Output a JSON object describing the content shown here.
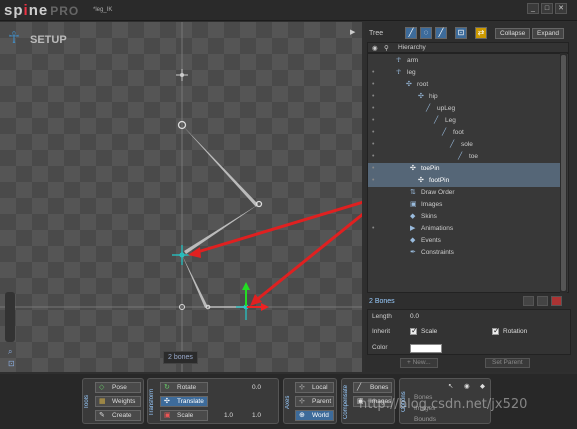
{
  "app": {
    "logo_main": "sp",
    "logo_dot": "i",
    "logo_end": "ne",
    "logo_pro": "PRO",
    "file_title": "*leg_IK",
    "min_label": "_",
    "max_label": "□",
    "close_label": "✕"
  },
  "viewport": {
    "mode_label": "SETUP",
    "status_label": "2 bones",
    "play_icon": "▶"
  },
  "tree_panel": {
    "title": "Tree",
    "collapse_label": "Collapse",
    "expand_label": "Expand",
    "header_label": "Hierarchy",
    "rows": [
      {
        "label": "arm",
        "icon": "figure-icon",
        "glyph": "☥",
        "indent": 28,
        "eye": "",
        "selected": false
      },
      {
        "label": "leg",
        "icon": "figure-icon",
        "glyph": "☥",
        "indent": 28,
        "eye": "•",
        "selected": false
      },
      {
        "label": "root",
        "icon": "root-bone-icon",
        "glyph": "✣",
        "indent": 38,
        "eye": "•",
        "selected": false
      },
      {
        "label": "hip",
        "icon": "bone-icon",
        "glyph": "✣",
        "indent": 50,
        "eye": "•",
        "selected": false
      },
      {
        "label": "upLeg",
        "icon": "bone-icon",
        "glyph": "╱",
        "indent": 58,
        "eye": "•",
        "selected": false
      },
      {
        "label": "Leg",
        "icon": "bone-icon",
        "glyph": "╱",
        "indent": 66,
        "eye": "•",
        "selected": false
      },
      {
        "label": "foot",
        "icon": "bone-icon",
        "glyph": "╱",
        "indent": 74,
        "eye": "•",
        "selected": false
      },
      {
        "label": "sole",
        "icon": "bone-icon",
        "glyph": "╱",
        "indent": 82,
        "eye": "•",
        "selected": false
      },
      {
        "label": "toe",
        "icon": "bone-icon",
        "glyph": "╱",
        "indent": 90,
        "eye": "•",
        "selected": false
      },
      {
        "label": "toePin",
        "icon": "target-bone-icon",
        "glyph": "✣",
        "indent": 42,
        "eye": "•",
        "selected": true
      },
      {
        "label": "footPin",
        "icon": "target-bone-icon",
        "glyph": "✣",
        "indent": 50,
        "eye": "•",
        "selected": true
      },
      {
        "label": "Draw Order",
        "icon": "draw-order-icon",
        "glyph": "⇅",
        "indent": 42,
        "eye": "",
        "selected": false
      },
      {
        "label": "Images",
        "icon": "images-icon",
        "glyph": "▣",
        "indent": 42,
        "eye": "",
        "selected": false
      },
      {
        "label": "Skins",
        "icon": "skins-icon",
        "glyph": "◆",
        "indent": 42,
        "eye": "",
        "selected": false
      },
      {
        "label": "Animations",
        "icon": "animations-icon",
        "glyph": "▶",
        "indent": 42,
        "eye": "•",
        "selected": false
      },
      {
        "label": "Events",
        "icon": "events-icon",
        "glyph": "◆",
        "indent": 42,
        "eye": "",
        "selected": false
      },
      {
        "label": "Constraints",
        "icon": "constraints-icon",
        "glyph": "✒",
        "indent": 42,
        "eye": "",
        "selected": false
      }
    ]
  },
  "properties": {
    "count_label": "2 Bones",
    "length_label": "Length",
    "length_value": "0.0",
    "inherit_label": "Inherit",
    "scale_label": "Scale",
    "rotation_label": "Rotation",
    "color_label": "Color",
    "new_label": "+ New...",
    "set_parent_label": "Set Parent"
  },
  "bottom": {
    "tools_label": "Tools",
    "pose_label": "Pose",
    "weights_label": "Weights",
    "create_label": "Create",
    "transform_label": "Transform",
    "rotate_label": "Rotate",
    "rotate_value": "0.0",
    "translate_label": "Translate",
    "scale_label": "Scale",
    "scale_x": "1.0",
    "scale_y": "1.0",
    "axes_label": "Axes",
    "local_label": "Local",
    "parent_label": "Parent",
    "world_label": "World",
    "compensate_label": "Compensate",
    "bones_label": "Bones",
    "images_label": "Images",
    "options_label": "Options",
    "opt_bones": "Bones",
    "opt_images": "Images",
    "opt_bounds": "Bounds"
  },
  "watermark": "http://blog.csdn.net/jx520",
  "colors": {
    "accent": "#3d6b9a",
    "ik_arrow": "#e02020",
    "selected_row": "#556677",
    "bone": "#c8c8c8"
  }
}
